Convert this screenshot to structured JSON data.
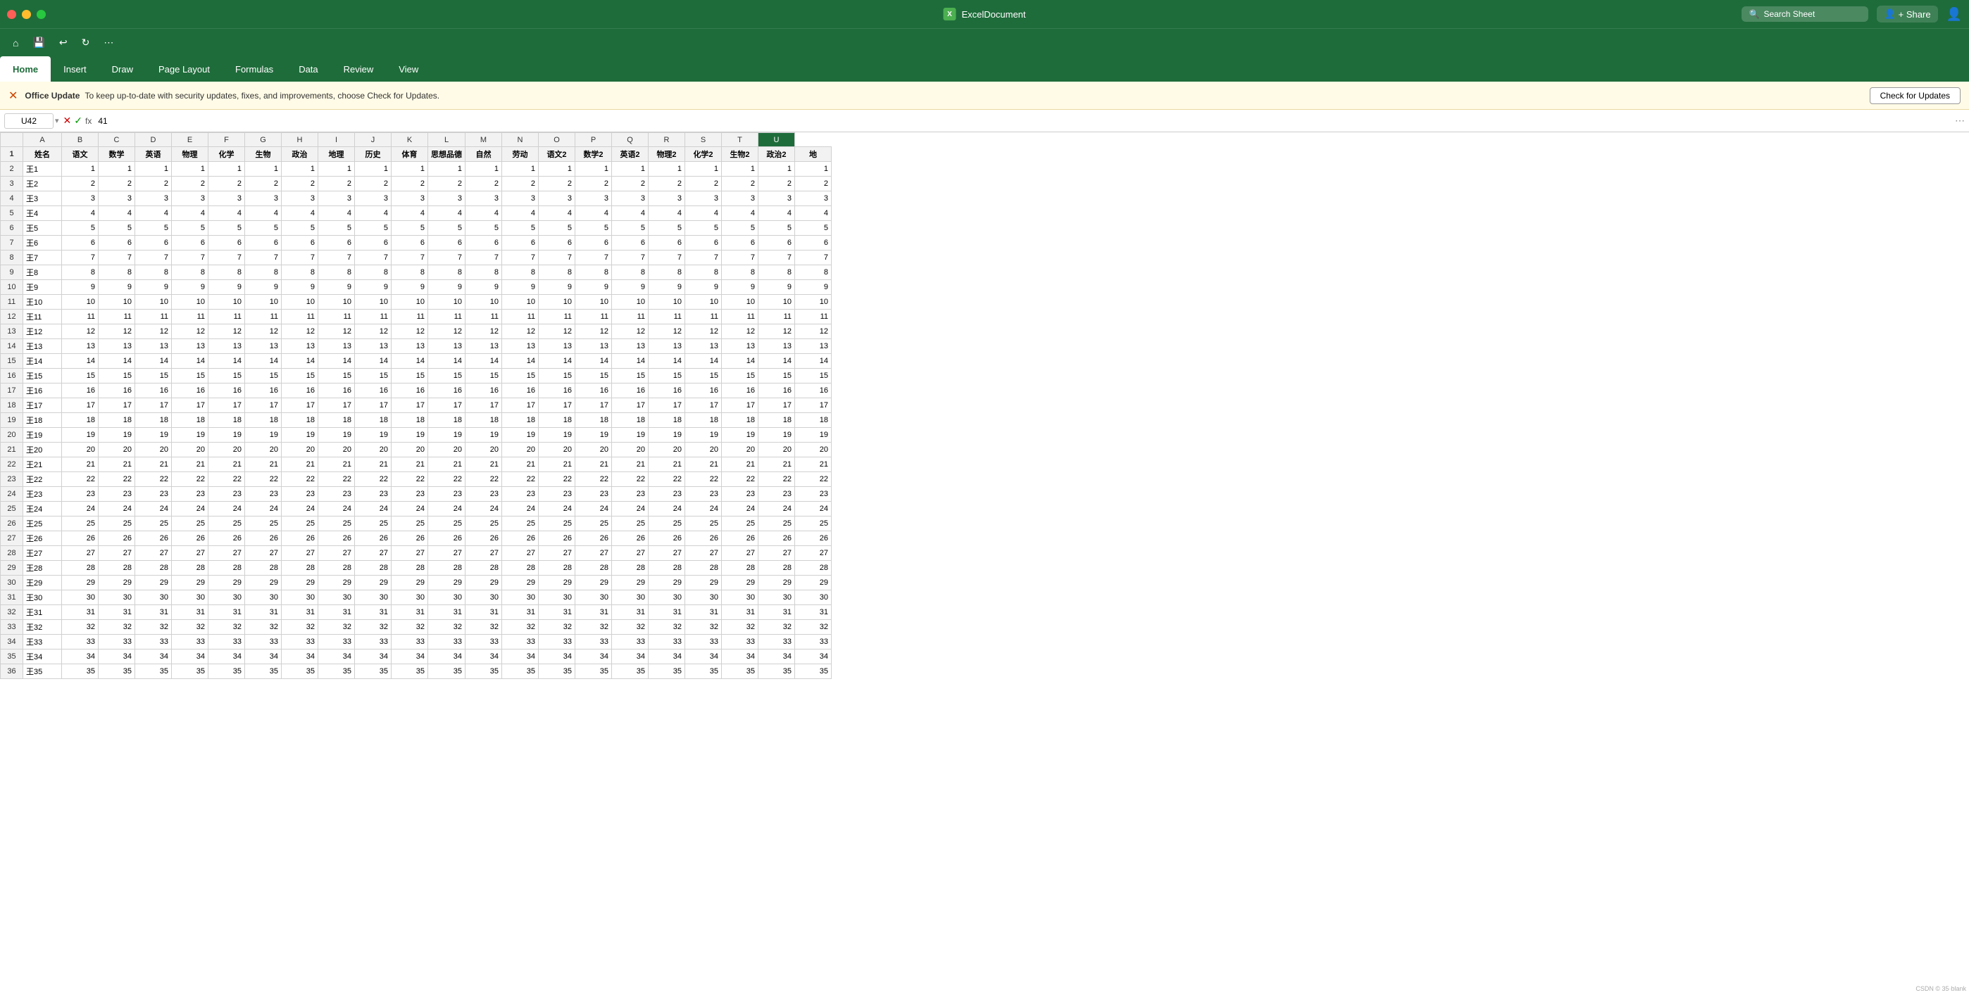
{
  "titlebar": {
    "app_icon": "X",
    "title": "ExcelDocument",
    "search_placeholder": "Search Sheet",
    "share_label": "+ Share",
    "window_controls": {
      "close": "close",
      "minimize": "minimize",
      "maximize": "maximize"
    }
  },
  "quick_toolbar": {
    "buttons": [
      "⌂",
      "💾",
      "↩",
      "↻",
      "⋯"
    ]
  },
  "ribbon": {
    "tabs": [
      "Home",
      "Insert",
      "Draw",
      "Page Layout",
      "Formulas",
      "Data",
      "Review",
      "View"
    ],
    "active_tab": "Home"
  },
  "update_bar": {
    "icon": "✕",
    "label": "Office Update",
    "message": "To keep up-to-date with security updates, fixes, and improvements, choose Check for Updates.",
    "button_label": "Check for Updates"
  },
  "formula_bar": {
    "cell_ref": "U42",
    "formula_value": "41",
    "fx_label": "fx"
  },
  "columns": [
    "A",
    "B",
    "C",
    "D",
    "E",
    "F",
    "G",
    "H",
    "I",
    "J",
    "K",
    "L",
    "M",
    "N",
    "O",
    "P",
    "Q",
    "R",
    "S",
    "T",
    "U"
  ],
  "col_headers": [
    "姓名",
    "语文",
    "数学",
    "英语",
    "物理",
    "化学",
    "生物",
    "政治",
    "地理",
    "历史",
    "体育",
    "思想品德",
    "自然",
    "劳动",
    "语文2",
    "数学2",
    "英语2",
    "物理2",
    "化学2",
    "生物2",
    "政治2",
    "地"
  ],
  "active_cell": "U42",
  "rows": [
    {
      "id": 1,
      "name": "王1",
      "vals": [
        1,
        1,
        1,
        1,
        1,
        1,
        1,
        1,
        1,
        1,
        1,
        1,
        1,
        1,
        1,
        1,
        1,
        1,
        1,
        1,
        1
      ]
    },
    {
      "id": 2,
      "name": "王2",
      "vals": [
        2,
        2,
        2,
        2,
        2,
        2,
        2,
        2,
        2,
        2,
        2,
        2,
        2,
        2,
        2,
        2,
        2,
        2,
        2,
        2,
        2
      ]
    },
    {
      "id": 3,
      "name": "王3",
      "vals": [
        3,
        3,
        3,
        3,
        3,
        3,
        3,
        3,
        3,
        3,
        3,
        3,
        3,
        3,
        3,
        3,
        3,
        3,
        3,
        3,
        3
      ]
    },
    {
      "id": 4,
      "name": "王4",
      "vals": [
        4,
        4,
        4,
        4,
        4,
        4,
        4,
        4,
        4,
        4,
        4,
        4,
        4,
        4,
        4,
        4,
        4,
        4,
        4,
        4,
        4
      ]
    },
    {
      "id": 5,
      "name": "王5",
      "vals": [
        5,
        5,
        5,
        5,
        5,
        5,
        5,
        5,
        5,
        5,
        5,
        5,
        5,
        5,
        5,
        5,
        5,
        5,
        5,
        5,
        5
      ]
    },
    {
      "id": 6,
      "name": "王6",
      "vals": [
        6,
        6,
        6,
        6,
        6,
        6,
        6,
        6,
        6,
        6,
        6,
        6,
        6,
        6,
        6,
        6,
        6,
        6,
        6,
        6,
        6
      ]
    },
    {
      "id": 7,
      "name": "王7",
      "vals": [
        7,
        7,
        7,
        7,
        7,
        7,
        7,
        7,
        7,
        7,
        7,
        7,
        7,
        7,
        7,
        7,
        7,
        7,
        7,
        7,
        7
      ]
    },
    {
      "id": 8,
      "name": "王8",
      "vals": [
        8,
        8,
        8,
        8,
        8,
        8,
        8,
        8,
        8,
        8,
        8,
        8,
        8,
        8,
        8,
        8,
        8,
        8,
        8,
        8,
        8
      ]
    },
    {
      "id": 9,
      "name": "王9",
      "vals": [
        9,
        9,
        9,
        9,
        9,
        9,
        9,
        9,
        9,
        9,
        9,
        9,
        9,
        9,
        9,
        9,
        9,
        9,
        9,
        9,
        9
      ]
    },
    {
      "id": 10,
      "name": "王10",
      "vals": [
        10,
        10,
        10,
        10,
        10,
        10,
        10,
        10,
        10,
        10,
        10,
        10,
        10,
        10,
        10,
        10,
        10,
        10,
        10,
        10,
        10
      ]
    },
    {
      "id": 11,
      "name": "王11",
      "vals": [
        11,
        11,
        11,
        11,
        11,
        11,
        11,
        11,
        11,
        11,
        11,
        11,
        11,
        11,
        11,
        11,
        11,
        11,
        11,
        11,
        11
      ]
    },
    {
      "id": 12,
      "name": "王12",
      "vals": [
        12,
        12,
        12,
        12,
        12,
        12,
        12,
        12,
        12,
        12,
        12,
        12,
        12,
        12,
        12,
        12,
        12,
        12,
        12,
        12,
        12
      ]
    },
    {
      "id": 13,
      "name": "王13",
      "vals": [
        13,
        13,
        13,
        13,
        13,
        13,
        13,
        13,
        13,
        13,
        13,
        13,
        13,
        13,
        13,
        13,
        13,
        13,
        13,
        13,
        13
      ]
    },
    {
      "id": 14,
      "name": "王14",
      "vals": [
        14,
        14,
        14,
        14,
        14,
        14,
        14,
        14,
        14,
        14,
        14,
        14,
        14,
        14,
        14,
        14,
        14,
        14,
        14,
        14,
        14
      ]
    },
    {
      "id": 15,
      "name": "王15",
      "vals": [
        15,
        15,
        15,
        15,
        15,
        15,
        15,
        15,
        15,
        15,
        15,
        15,
        15,
        15,
        15,
        15,
        15,
        15,
        15,
        15,
        15
      ]
    },
    {
      "id": 16,
      "name": "王16",
      "vals": [
        16,
        16,
        16,
        16,
        16,
        16,
        16,
        16,
        16,
        16,
        16,
        16,
        16,
        16,
        16,
        16,
        16,
        16,
        16,
        16,
        16
      ]
    },
    {
      "id": 17,
      "name": "王17",
      "vals": [
        17,
        17,
        17,
        17,
        17,
        17,
        17,
        17,
        17,
        17,
        17,
        17,
        17,
        17,
        17,
        17,
        17,
        17,
        17,
        17,
        17
      ]
    },
    {
      "id": 18,
      "name": "王18",
      "vals": [
        18,
        18,
        18,
        18,
        18,
        18,
        18,
        18,
        18,
        18,
        18,
        18,
        18,
        18,
        18,
        18,
        18,
        18,
        18,
        18,
        18
      ]
    },
    {
      "id": 19,
      "name": "王19",
      "vals": [
        19,
        19,
        19,
        19,
        19,
        19,
        19,
        19,
        19,
        19,
        19,
        19,
        19,
        19,
        19,
        19,
        19,
        19,
        19,
        19,
        19
      ]
    },
    {
      "id": 20,
      "name": "王20",
      "vals": [
        20,
        20,
        20,
        20,
        20,
        20,
        20,
        20,
        20,
        20,
        20,
        20,
        20,
        20,
        20,
        20,
        20,
        20,
        20,
        20,
        20
      ]
    },
    {
      "id": 21,
      "name": "王21",
      "vals": [
        21,
        21,
        21,
        21,
        21,
        21,
        21,
        21,
        21,
        21,
        21,
        21,
        21,
        21,
        21,
        21,
        21,
        21,
        21,
        21,
        21
      ]
    },
    {
      "id": 22,
      "name": "王22",
      "vals": [
        22,
        22,
        22,
        22,
        22,
        22,
        22,
        22,
        22,
        22,
        22,
        22,
        22,
        22,
        22,
        22,
        22,
        22,
        22,
        22,
        22
      ]
    },
    {
      "id": 23,
      "name": "王23",
      "vals": [
        23,
        23,
        23,
        23,
        23,
        23,
        23,
        23,
        23,
        23,
        23,
        23,
        23,
        23,
        23,
        23,
        23,
        23,
        23,
        23,
        23
      ]
    },
    {
      "id": 24,
      "name": "王24",
      "vals": [
        24,
        24,
        24,
        24,
        24,
        24,
        24,
        24,
        24,
        24,
        24,
        24,
        24,
        24,
        24,
        24,
        24,
        24,
        24,
        24,
        24
      ]
    },
    {
      "id": 25,
      "name": "王25",
      "vals": [
        25,
        25,
        25,
        25,
        25,
        25,
        25,
        25,
        25,
        25,
        25,
        25,
        25,
        25,
        25,
        25,
        25,
        25,
        25,
        25,
        25
      ]
    },
    {
      "id": 26,
      "name": "王26",
      "vals": [
        26,
        26,
        26,
        26,
        26,
        26,
        26,
        26,
        26,
        26,
        26,
        26,
        26,
        26,
        26,
        26,
        26,
        26,
        26,
        26,
        26
      ]
    },
    {
      "id": 27,
      "name": "王27",
      "vals": [
        27,
        27,
        27,
        27,
        27,
        27,
        27,
        27,
        27,
        27,
        27,
        27,
        27,
        27,
        27,
        27,
        27,
        27,
        27,
        27,
        27
      ]
    },
    {
      "id": 28,
      "name": "王28",
      "vals": [
        28,
        28,
        28,
        28,
        28,
        28,
        28,
        28,
        28,
        28,
        28,
        28,
        28,
        28,
        28,
        28,
        28,
        28,
        28,
        28,
        28
      ]
    },
    {
      "id": 29,
      "name": "王29",
      "vals": [
        29,
        29,
        29,
        29,
        29,
        29,
        29,
        29,
        29,
        29,
        29,
        29,
        29,
        29,
        29,
        29,
        29,
        29,
        29,
        29,
        29
      ]
    },
    {
      "id": 30,
      "name": "王30",
      "vals": [
        30,
        30,
        30,
        30,
        30,
        30,
        30,
        30,
        30,
        30,
        30,
        30,
        30,
        30,
        30,
        30,
        30,
        30,
        30,
        30,
        30
      ]
    },
    {
      "id": 31,
      "name": "王31",
      "vals": [
        31,
        31,
        31,
        31,
        31,
        31,
        31,
        31,
        31,
        31,
        31,
        31,
        31,
        31,
        31,
        31,
        31,
        31,
        31,
        31,
        31
      ]
    },
    {
      "id": 32,
      "name": "王32",
      "vals": [
        32,
        32,
        32,
        32,
        32,
        32,
        32,
        32,
        32,
        32,
        32,
        32,
        32,
        32,
        32,
        32,
        32,
        32,
        32,
        32,
        32
      ]
    },
    {
      "id": 33,
      "name": "王33",
      "vals": [
        33,
        33,
        33,
        33,
        33,
        33,
        33,
        33,
        33,
        33,
        33,
        33,
        33,
        33,
        33,
        33,
        33,
        33,
        33,
        33,
        33
      ]
    },
    {
      "id": 34,
      "name": "王34",
      "vals": [
        34,
        34,
        34,
        34,
        34,
        34,
        34,
        34,
        34,
        34,
        34,
        34,
        34,
        34,
        34,
        34,
        34,
        34,
        34,
        34,
        34
      ]
    },
    {
      "id": 35,
      "name": "王35",
      "vals": [
        35,
        35,
        35,
        35,
        35,
        35,
        35,
        35,
        35,
        35,
        35,
        35,
        35,
        35,
        35,
        35,
        35,
        35,
        35,
        35,
        35
      ]
    }
  ]
}
